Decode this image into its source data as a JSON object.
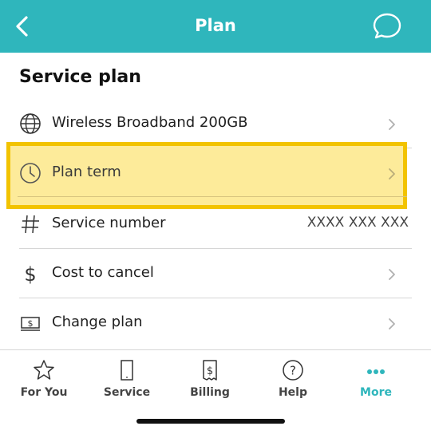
{
  "header": {
    "title": "Plan",
    "back_icon": "chevron-left-icon",
    "chat_icon": "chat-bubble-icon"
  },
  "section": {
    "title": "Service plan"
  },
  "rows": [
    {
      "label": "Wireless Broadband 200GB",
      "icon": "globe-icon",
      "chevron": true
    },
    {
      "label": "Plan term",
      "icon": "clock-icon",
      "chevron": true,
      "highlighted": true
    },
    {
      "label": "Service number",
      "icon": "hash-icon",
      "value": "XXXX XXX XXX"
    },
    {
      "label": "Cost to cancel",
      "icon": "dollar-icon",
      "chevron": true
    },
    {
      "label": "Change plan",
      "icon": "bill-icon",
      "chevron": true
    }
  ],
  "tabs": [
    {
      "label": "For You",
      "icon": "star-icon"
    },
    {
      "label": "Service",
      "icon": "phone-icon"
    },
    {
      "label": "Billing",
      "icon": "billing-icon"
    },
    {
      "label": "Help",
      "icon": "help-icon"
    },
    {
      "label": "More",
      "icon": "more-icon",
      "active": true
    }
  ],
  "colors": {
    "accent": "#2fb6bc",
    "highlight_fill": "#fdeb9a",
    "highlight_border": "#f2c300"
  }
}
